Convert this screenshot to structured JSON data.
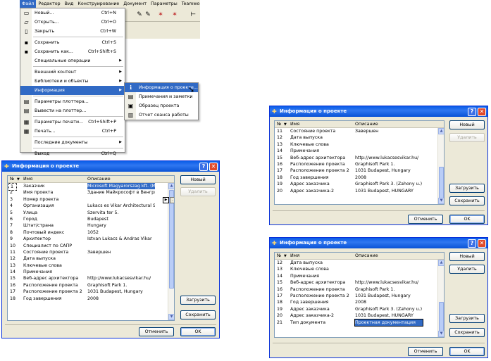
{
  "menubar": [
    "Файл",
    "Редактор",
    "Вид",
    "Конструирование",
    "Документ",
    "Параметры",
    "Teamwork",
    "Окно"
  ],
  "file_menu": [
    {
      "label": "Новый...",
      "shortcut": "Ctrl+N",
      "icon": "new-file-icon"
    },
    {
      "label": "Открыть...",
      "shortcut": "Ctrl+O",
      "icon": "open-folder-icon"
    },
    {
      "label": "Закрыть",
      "shortcut": "Ctrl+W",
      "icon": "close-file-icon"
    },
    {
      "sep": true
    },
    {
      "label": "Сохранить",
      "shortcut": "Ctrl+S",
      "icon": "save-icon"
    },
    {
      "label": "Сохранить как...",
      "shortcut": "Ctrl+Shift+S",
      "icon": "save-as-icon"
    },
    {
      "label": "Специальные операции",
      "arrow": true
    },
    {
      "sep": true
    },
    {
      "label": "Внешний контент",
      "arrow": true
    },
    {
      "label": "Библиотеки и объекты",
      "arrow": true
    },
    {
      "label": "Информация",
      "arrow": true,
      "highlight": true
    },
    {
      "sep": true
    },
    {
      "label": "Параметры плоттера...",
      "icon": "plotter-settings-icon"
    },
    {
      "label": "Вывести на плоттер...",
      "icon": "plotter-icon"
    },
    {
      "sep": true
    },
    {
      "label": "Параметры печати...",
      "shortcut": "Ctrl+Shift+P",
      "icon": "print-settings-icon"
    },
    {
      "label": "Печать...",
      "shortcut": "Ctrl+P",
      "icon": "printer-icon"
    },
    {
      "sep": true
    },
    {
      "label": "Последние документы",
      "arrow": true
    },
    {
      "sep": true
    },
    {
      "label": "Выход",
      "shortcut": "Ctrl+Q"
    }
  ],
  "info_submenu": [
    {
      "label": "Информация о проекте...",
      "icon": "info-icon",
      "highlight": true
    },
    {
      "label": "Примечания и заметки",
      "icon": "notes-icon"
    },
    {
      "label": "Образец проекта",
      "icon": "project-sample-icon"
    },
    {
      "label": "Отчет сеанса работы",
      "icon": "report-icon"
    }
  ],
  "dialog": {
    "title": "Информация о проекте",
    "col_num": "№",
    "col_name": "Имя",
    "col_desc": "Описание",
    "btn_new": "Новый",
    "btn_delete": "Удалить",
    "btn_load": "Загрузить",
    "btn_save": "Сохранить",
    "btn_cancel": "Отменить",
    "btn_ok": "OK"
  },
  "dialog1_rows": [
    {
      "n": "1",
      "name": "Заказчик",
      "desc": "Microsoft Magyarorszag kft. (Mi...",
      "sel": true
    },
    {
      "n": "2",
      "name": "Имя проекта",
      "desc": "Здание Майкрософт в Венгрии"
    },
    {
      "n": "3",
      "name": "Номер проекта",
      "desc": ""
    },
    {
      "n": "4",
      "name": "Организация",
      "desc": "Lukacs es Vikar Architectural St..."
    },
    {
      "n": "5",
      "name": "Улица",
      "desc": "Szervita ter 5."
    },
    {
      "n": "6",
      "name": "Город",
      "desc": "Budapest"
    },
    {
      "n": "7",
      "name": "Штат/страна",
      "desc": "Hungary"
    },
    {
      "n": "8",
      "name": "Почтовый индекс",
      "desc": "1052"
    },
    {
      "n": "9",
      "name": "Архитектор",
      "desc": "Istvan Lukacs & Andras Vikar"
    },
    {
      "n": "10",
      "name": "Специалист по САПР",
      "desc": ""
    },
    {
      "n": "11",
      "name": "Состояние проекта",
      "desc": "Завершен"
    },
    {
      "n": "12",
      "name": "Дата выпуска",
      "desc": ""
    },
    {
      "n": "13",
      "name": "Ключевые слова",
      "desc": ""
    },
    {
      "n": "14",
      "name": "Примечания",
      "desc": ""
    },
    {
      "n": "15",
      "name": "Веб-адрес архитектора",
      "desc": "http://www.lukacsesvikar.hu/"
    },
    {
      "n": "16",
      "name": "Расположение проекта",
      "desc": "Graphisoft Park 1."
    },
    {
      "n": "17",
      "name": "Расположение проекта 2",
      "desc": "1031 Budapest, Hungary"
    },
    {
      "n": "18",
      "name": "Год завершения",
      "desc": "2008"
    }
  ],
  "dialog2_rows": [
    {
      "n": "11",
      "name": "Состояние проекта",
      "desc": "Завершен"
    },
    {
      "n": "12",
      "name": "Дата выпуска",
      "desc": ""
    },
    {
      "n": "13",
      "name": "Ключевые слова",
      "desc": ""
    },
    {
      "n": "14",
      "name": "Примечания",
      "desc": ""
    },
    {
      "n": "15",
      "name": "Веб-адрес архитектора",
      "desc": "http://www.lukacsesvikar.hu/"
    },
    {
      "n": "16",
      "name": "Расположение проекта",
      "desc": "Graphisoft Park 1."
    },
    {
      "n": "17",
      "name": "Расположение проекта 2",
      "desc": "1031 Budapest, Hungary"
    },
    {
      "n": "18",
      "name": "Год завершения",
      "desc": "2008"
    },
    {
      "n": "19",
      "name": "Адрес заказчика",
      "desc": "Graphisoft Park 3. (Zahony u.)"
    },
    {
      "n": "20",
      "name": "Адрес заказчика-2",
      "desc": "1031 Budapest, HUNGARY"
    }
  ],
  "dialog3_rows": [
    {
      "n": "12",
      "name": "Дата выпуска",
      "desc": ""
    },
    {
      "n": "13",
      "name": "Ключевые слова",
      "desc": ""
    },
    {
      "n": "14",
      "name": "Примечания",
      "desc": ""
    },
    {
      "n": "15",
      "name": "Веб-адрес архитектора",
      "desc": "http://www.lukacsesvikar.hu/"
    },
    {
      "n": "16",
      "name": "Расположение проекта",
      "desc": "Graphisoft Park 1."
    },
    {
      "n": "17",
      "name": "Расположение проекта 2",
      "desc": "1031 Budapest, Hungary"
    },
    {
      "n": "18",
      "name": "Год завершения",
      "desc": "2008"
    },
    {
      "n": "19",
      "name": "Адрес заказчика",
      "desc": "Graphisoft Park 3. (Zahony u.)"
    },
    {
      "n": "20",
      "name": "Адрес заказчика-2",
      "desc": "1031 Budapest, HUNGARY"
    },
    {
      "n": "21",
      "name": "Тип документа",
      "desc": "Проектная документация",
      "edit": true
    }
  ],
  "colors": {
    "accent": "#316ac5",
    "titlebar": "#0a5ce8",
    "dialog_bg": "#ece9d8"
  }
}
